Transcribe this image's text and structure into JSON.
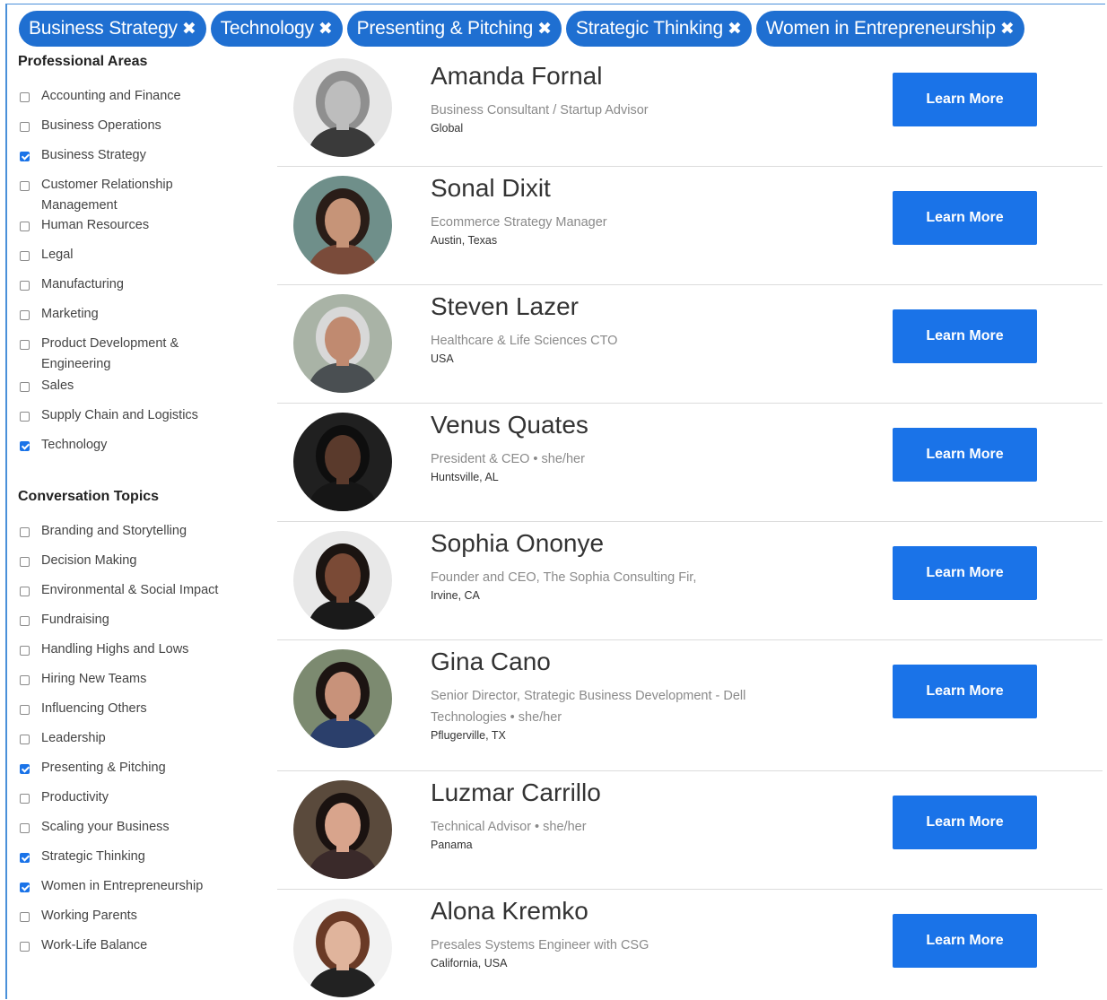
{
  "filters": {
    "chips": [
      {
        "label": "Business Strategy"
      },
      {
        "label": "Technology"
      },
      {
        "label": "Presenting & Pitching"
      },
      {
        "label": "Strategic Thinking"
      },
      {
        "label": "Women in Entrepreneurship"
      }
    ],
    "remove_icon": "close-x-icon"
  },
  "sidebar": {
    "professional_areas": {
      "title": "Professional Areas",
      "items": [
        {
          "label": "Accounting and Finance",
          "checked": false
        },
        {
          "label": "Business Operations",
          "checked": false
        },
        {
          "label": "Business Strategy",
          "checked": true
        },
        {
          "label": "Customer Relationship Management",
          "checked": false
        },
        {
          "label": "Human Resources",
          "checked": false
        },
        {
          "label": "Legal",
          "checked": false
        },
        {
          "label": "Manufacturing",
          "checked": false
        },
        {
          "label": "Marketing",
          "checked": false
        },
        {
          "label": "Product Development & Engineering",
          "checked": false
        },
        {
          "label": "Sales",
          "checked": false
        },
        {
          "label": "Supply Chain and Logistics",
          "checked": false
        },
        {
          "label": "Technology",
          "checked": true
        }
      ]
    },
    "conversation_topics": {
      "title": "Conversation Topics",
      "items": [
        {
          "label": "Branding and Storytelling",
          "checked": false
        },
        {
          "label": "Decision Making",
          "checked": false
        },
        {
          "label": "Environmental & Social Impact",
          "checked": false
        },
        {
          "label": "Fundraising",
          "checked": false
        },
        {
          "label": "Handling Highs and Lows",
          "checked": false
        },
        {
          "label": "Hiring New Teams",
          "checked": false
        },
        {
          "label": "Influencing Others",
          "checked": false
        },
        {
          "label": "Leadership",
          "checked": false
        },
        {
          "label": "Presenting & Pitching",
          "checked": true
        },
        {
          "label": "Productivity",
          "checked": false
        },
        {
          "label": "Scaling your Business",
          "checked": false
        },
        {
          "label": "Strategic Thinking",
          "checked": true
        },
        {
          "label": "Women in Entrepreneurship",
          "checked": true
        },
        {
          "label": "Working Parents",
          "checked": false
        },
        {
          "label": "Work-Life Balance",
          "checked": false
        }
      ]
    }
  },
  "mentors": [
    {
      "name": "Amanda Fornal",
      "role": "Business Consultant / Startup Advisor",
      "location": "Global"
    },
    {
      "name": "Sonal Dixit",
      "role": "Ecommerce Strategy Manager",
      "location": "Austin, Texas"
    },
    {
      "name": "Steven Lazer",
      "role": "Healthcare & Life Sciences CTO",
      "location": "USA"
    },
    {
      "name": "Venus Quates",
      "role": "President & CEO • she/her",
      "location": "Huntsville, AL"
    },
    {
      "name": "Sophia Ononye",
      "role": "Founder and CEO, The Sophia Consulting Fir,",
      "location": "Irvine, CA"
    },
    {
      "name": "Gina Cano",
      "role": "Senior Director, Strategic Business Development - Dell Technologies • she/her",
      "location": "Pflugerville, TX"
    },
    {
      "name": "Luzmar Carrillo",
      "role": "Technical Advisor • she/her",
      "location": "Panama"
    },
    {
      "name": "Alona Kremko",
      "role": "Presales Systems Engineer with CSG",
      "location": "California, USA"
    }
  ],
  "button_label": "Learn More",
  "colors": {
    "chip_bg": "#1f6fd1",
    "button_bg": "#1a73e8",
    "checkbox_checked": "#1a73e8"
  },
  "avatar_palettes": [
    {
      "bg": "#e6e6e6",
      "hair": "#8f8f8f",
      "skin": "#bdbdbd",
      "shirt": "#3a3a3a"
    },
    {
      "bg": "#6f8f8a",
      "hair": "#2a1d18",
      "skin": "#c69478",
      "shirt": "#7a4b3a"
    },
    {
      "bg": "#a9b3a6",
      "hair": "#d8d8d8",
      "skin": "#c08a70",
      "shirt": "#4a4f52"
    },
    {
      "bg": "#202020",
      "hair": "#0e0e0e",
      "skin": "#5a3a2c",
      "shirt": "#161616"
    },
    {
      "bg": "#e8e8e8",
      "hair": "#1b1411",
      "skin": "#7a4a36",
      "shirt": "#1a1a1a"
    },
    {
      "bg": "#7c8a70",
      "hair": "#1c1412",
      "skin": "#c8927a",
      "shirt": "#2b3f6b"
    },
    {
      "bg": "#5a4a3c",
      "hair": "#1a1210",
      "skin": "#d8a48c",
      "shirt": "#3a2a2a"
    },
    {
      "bg": "#f2f2f2",
      "hair": "#6a3a26",
      "skin": "#e0b49c",
      "shirt": "#222222"
    }
  ]
}
